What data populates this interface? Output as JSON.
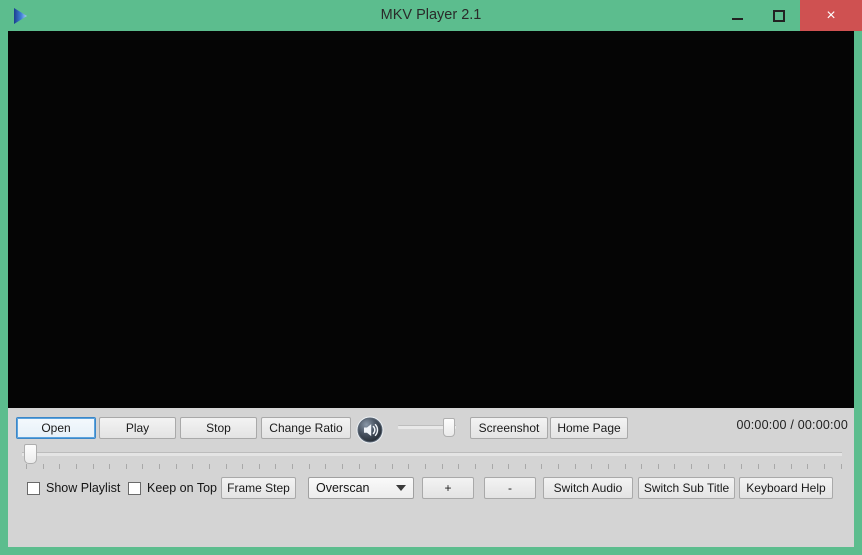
{
  "window": {
    "title": "MKV Player 2.1",
    "app_icon": "play-triangle-icon",
    "frame_color": "#5cbd8e",
    "panel_color": "#d4d4d4",
    "video_color": "#050505",
    "controls": {
      "minimize": "minimize-icon",
      "maximize": "maximize-icon",
      "close": "×",
      "close_color": "#cf5151"
    }
  },
  "transport": {
    "open_label": "Open",
    "play_label": "Play",
    "stop_label": "Stop",
    "change_ratio_label": "Change Ratio",
    "volume_icon": "speaker-volume-icon",
    "screenshot_label": "Screenshot",
    "home_page_label": "Home Page",
    "time_display": "00:00:00 / 00:00:00",
    "volume_value": 88
  },
  "seek": {
    "position": 0
  },
  "options": {
    "show_playlist_label": "Show Playlist",
    "show_playlist_checked": false,
    "keep_on_top_label": "Keep on Top",
    "keep_on_top_checked": false,
    "frame_step_label": "Frame Step",
    "overscan_selected": "Overscan",
    "plus_label": "+",
    "minus_label": "-",
    "switch_audio_label": "Switch Audio",
    "switch_sub_title_label": "Switch Sub Title",
    "keyboard_help_label": "Keyboard Help"
  }
}
